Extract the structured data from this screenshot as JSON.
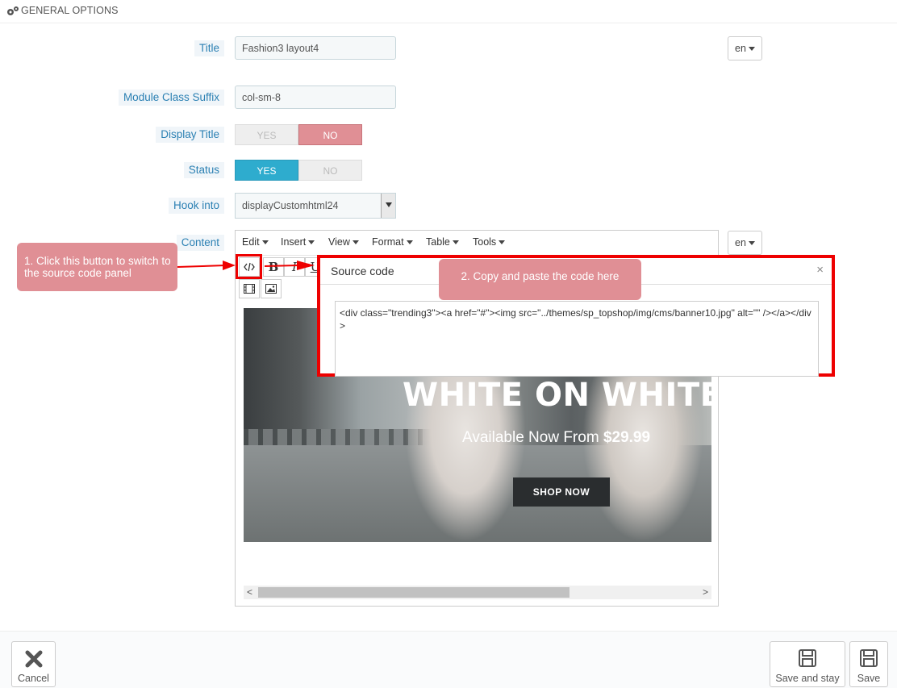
{
  "panel": {
    "title": "GENERAL OPTIONS",
    "icon": "gears-icon"
  },
  "form": {
    "title": {
      "label": "Title",
      "value": "Fashion3 layout4",
      "lang": "en"
    },
    "suffix": {
      "label": "Module Class Suffix",
      "value": "col-sm-8"
    },
    "display_title": {
      "label": "Display Title",
      "yes": "YES",
      "no": "NO",
      "selected": "NO"
    },
    "status": {
      "label": "Status",
      "yes": "YES",
      "no": "NO",
      "selected": "YES"
    },
    "hook": {
      "label": "Hook into",
      "value": "displayCustomhtml24"
    },
    "content": {
      "label": "Content",
      "lang": "en"
    }
  },
  "editor": {
    "menus": [
      "Edit",
      "Insert",
      "View",
      "Format",
      "Table",
      "Tools"
    ],
    "tool_icons": [
      "source-code-icon",
      "bold-icon",
      "italic-icon",
      "underline-icon",
      "media-icon",
      "image-icon"
    ],
    "banner": {
      "headline": "WHITE ON WHITE",
      "sub_prefix": "Available Now From ",
      "sub_price": "$29.99",
      "cta": "SHOP NOW"
    }
  },
  "dialog": {
    "title": "Source code",
    "close": "×",
    "code": "<div class=\"trending3\"><a href=\"#\"><img src=\"../themes/sp_topshop/img/cms/banner10.jpg\" alt=\"\" /></a></div>"
  },
  "annotations": {
    "step1": "1. Click this button to switch to the source code panel",
    "step2": "2. Copy and paste the code here",
    "accent": "#e08f95",
    "highlight": "#ee0000"
  },
  "footer": {
    "cancel": "Cancel",
    "save_stay": "Save and stay",
    "save": "Save"
  }
}
